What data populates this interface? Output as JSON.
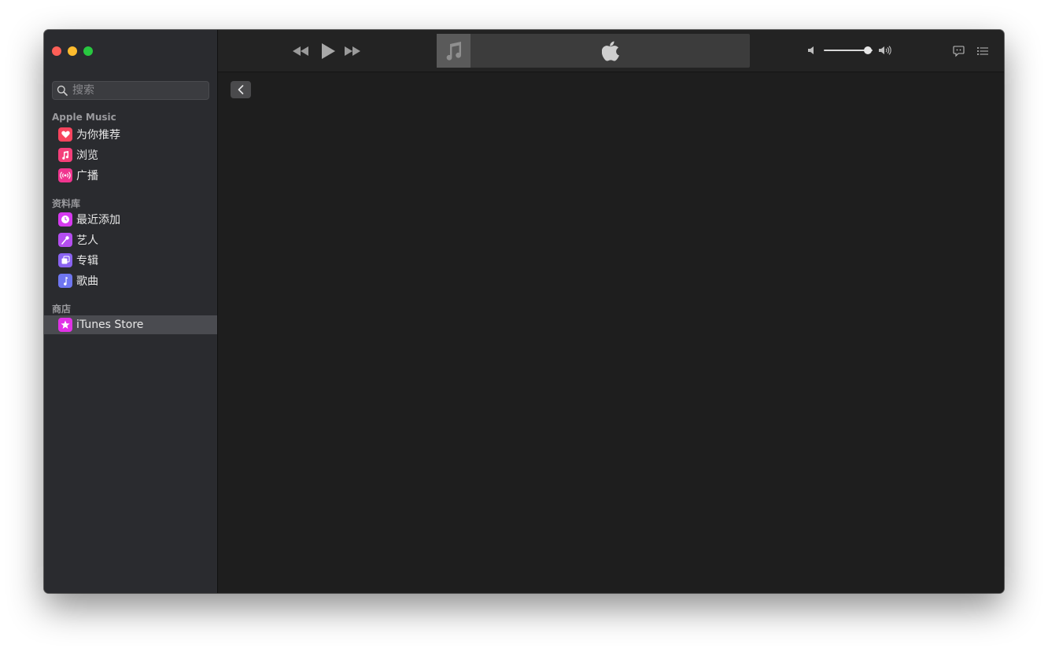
{
  "search": {
    "placeholder": "搜索"
  },
  "sections": {
    "apple_music": "Apple Music",
    "library": "资料库",
    "store": "商店"
  },
  "apple_music_items": [
    {
      "label": "为你推荐",
      "icon": "heart-icon",
      "color": "#f7445e"
    },
    {
      "label": "浏览",
      "icon": "music-note-icon",
      "color": "#f43f7a"
    },
    {
      "label": "广播",
      "icon": "radio-broadcast-icon",
      "color": "#f0358f"
    }
  ],
  "library_items": [
    {
      "label": "最近添加",
      "icon": "clock-icon",
      "color": "#d63af0"
    },
    {
      "label": "艺人",
      "icon": "microphone-icon",
      "color": "#b44ef0"
    },
    {
      "label": "专辑",
      "icon": "album-stack-icon",
      "color": "#8a63f0"
    },
    {
      "label": "歌曲",
      "icon": "music-note-icon",
      "color": "#6f76f0"
    }
  ],
  "store_items": [
    {
      "label": "iTunes Store",
      "icon": "star-icon",
      "color": "#e032e6",
      "selected": true
    }
  ],
  "volume": {
    "level": 0.9
  }
}
